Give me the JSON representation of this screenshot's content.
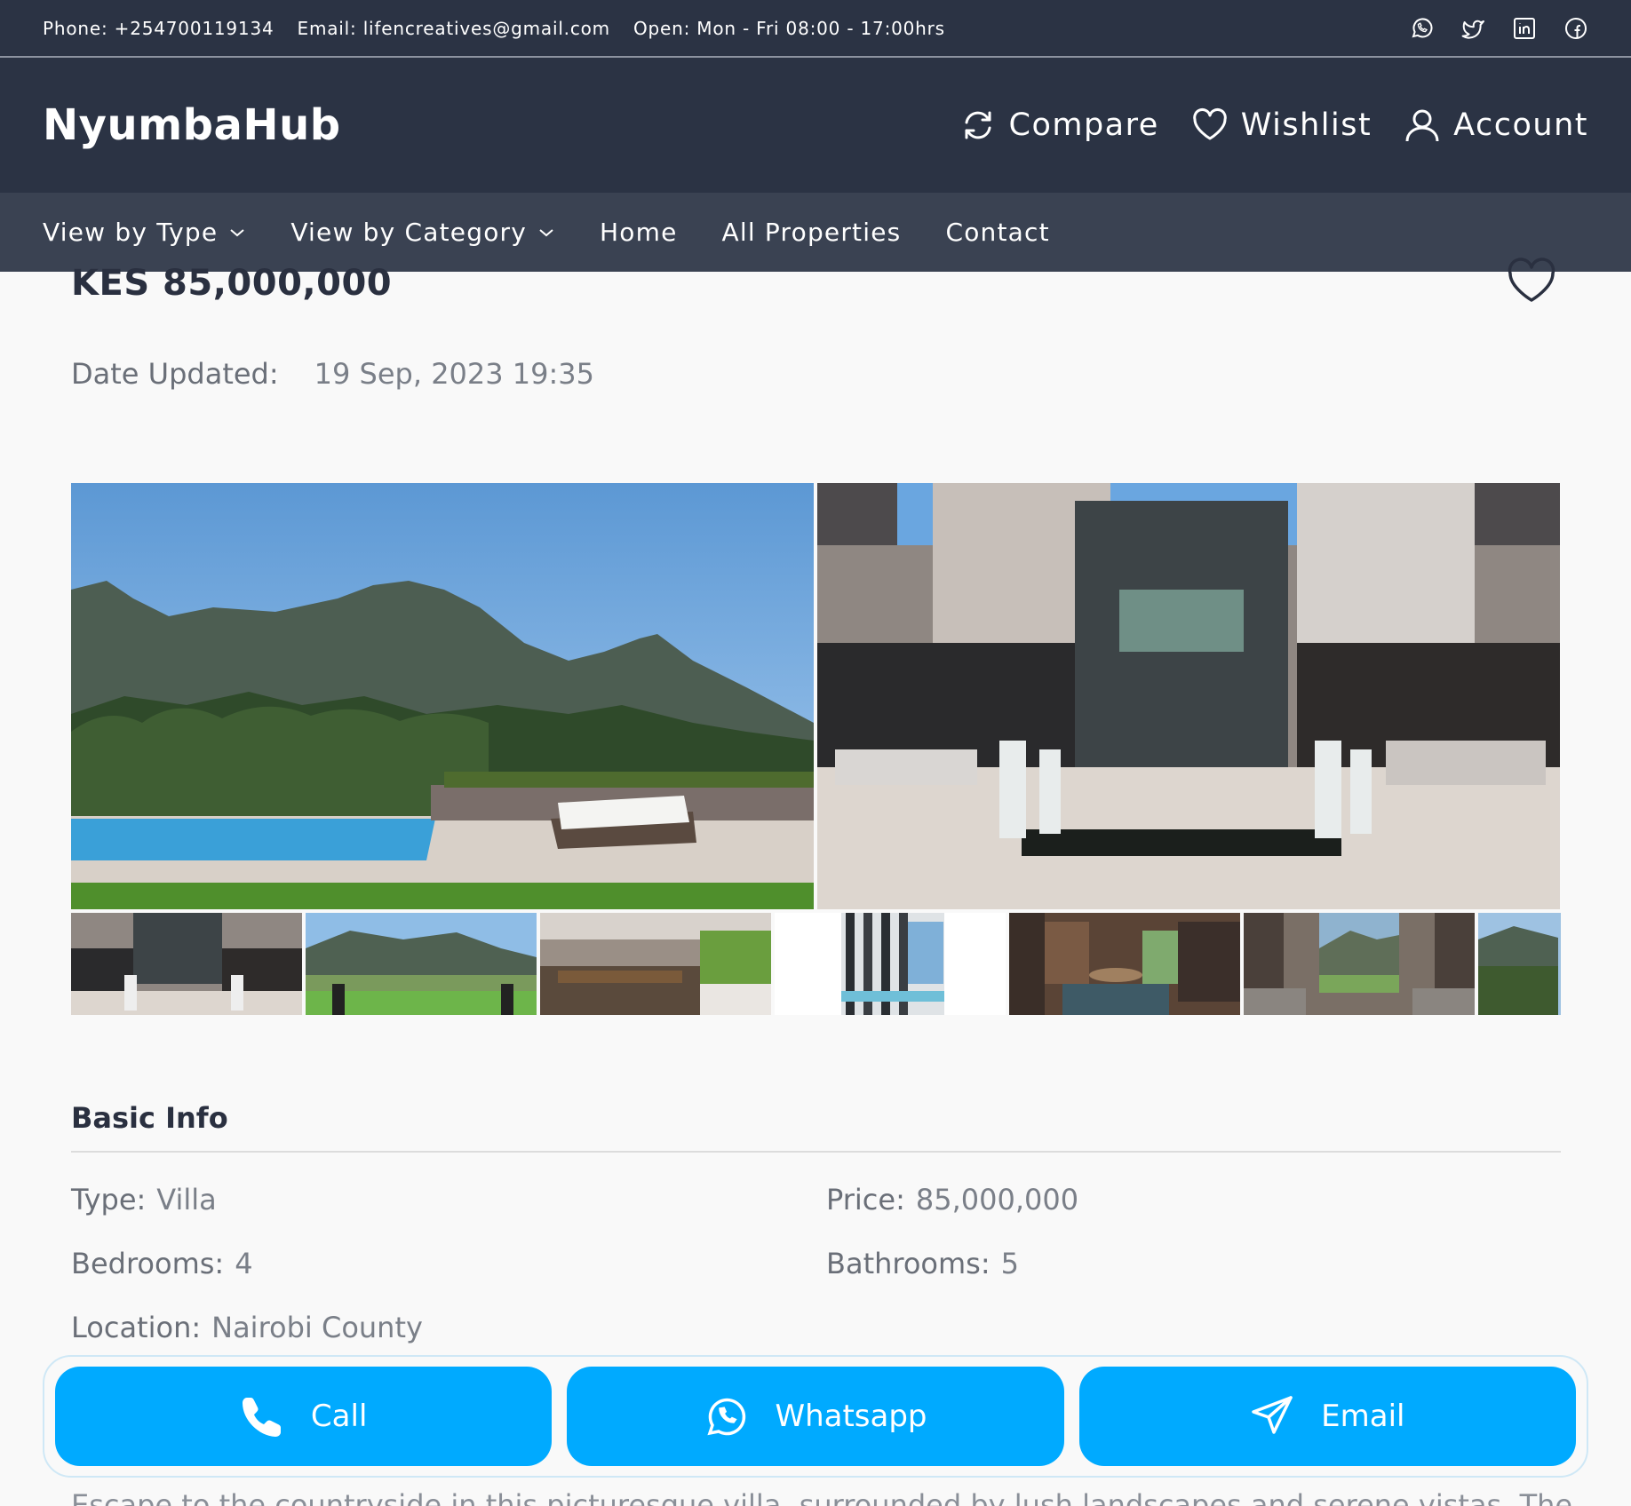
{
  "topbar": {
    "phone": "Phone: +254700119134",
    "email": "Email: lifencreatives@gmail.com",
    "hours": "Open: Mon - Fri 08:00 - 17:00hrs",
    "socials": [
      "whatsapp-icon",
      "twitter-icon",
      "linkedin-icon",
      "facebook-icon"
    ]
  },
  "header": {
    "brand": "NyumbaHub",
    "compare": "Compare",
    "wishlist": "Wishlist",
    "account": "Account"
  },
  "nav": {
    "type": "View by Type",
    "category": "View by Category",
    "home": "Home",
    "all": "All Properties",
    "contact": "Contact"
  },
  "listing": {
    "price": "KES 85,000,000",
    "updated_label": "Date Updated:",
    "updated_value": "19 Sep, 2023 19:35"
  },
  "basic_info": {
    "title": "Basic Info",
    "type_label": "Type:",
    "type_value": "Villa",
    "price_label": "Price:",
    "price_value": "85,000,000",
    "bedrooms_label": "Bedrooms:",
    "bedrooms_value": "4",
    "bathrooms_label": "Bathrooms:",
    "bathrooms_value": "5",
    "location_label": "Location:",
    "location_value": "Nairobi County"
  },
  "description_peek": "Escape to the countryside in this picturesque villa, surrounded by lush landscapes and serene vistas. The",
  "contact": {
    "call": "Call",
    "whatsapp": "Whatsapp",
    "email": "Email"
  },
  "colors": {
    "topbar_bg": "#2b3344",
    "nav_bg": "#3a4252",
    "accent": "#00aaff"
  }
}
